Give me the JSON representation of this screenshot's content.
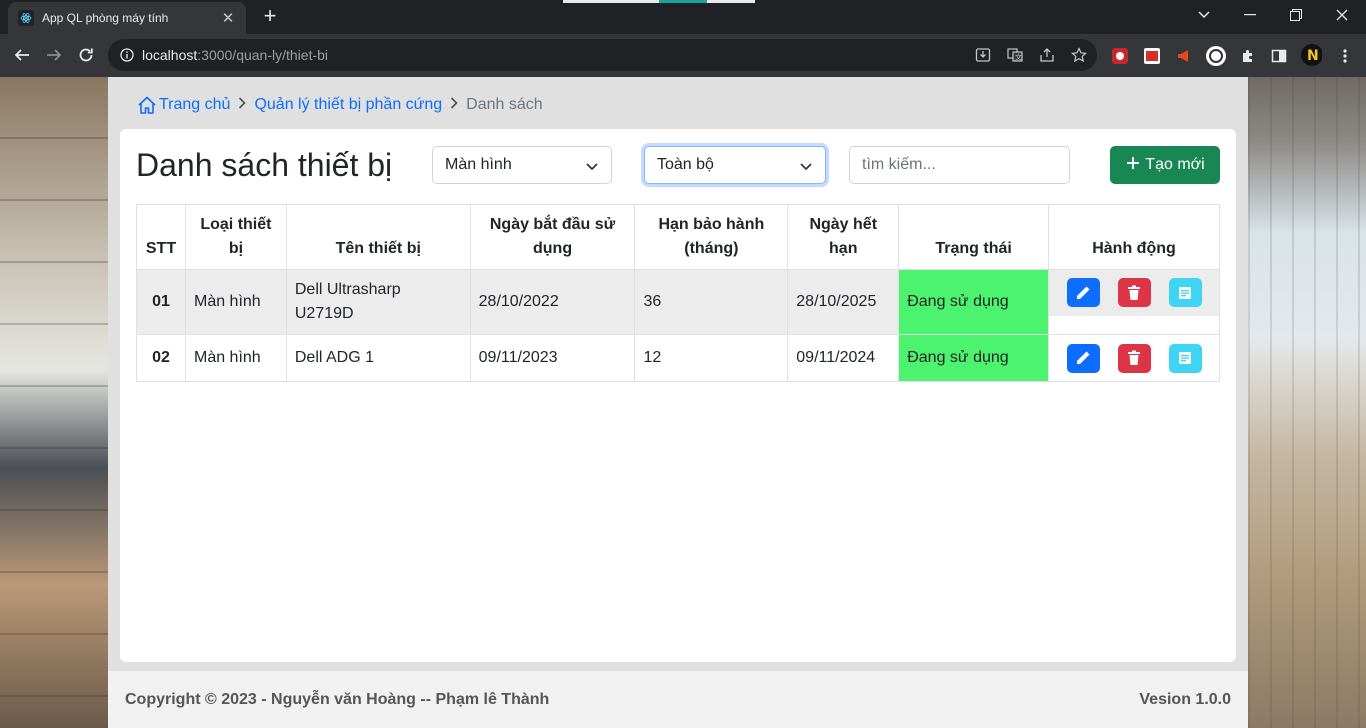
{
  "browser": {
    "tab_title": "App QL phòng máy tính",
    "url_host": "localhost",
    "url_path": ":3000/quan-ly/thiet-bi"
  },
  "breadcrumb": {
    "home": "Trang chủ",
    "section": "Quản lý thiết bị phần cứng",
    "current": "Danh sách"
  },
  "page": {
    "title": "Danh sách thiết bị",
    "type_filter": "Màn hình",
    "status_filter": "Toàn bộ",
    "search_placeholder": "tìm kiếm...",
    "create_label": "Tạo mới"
  },
  "table": {
    "headers": {
      "stt": "STT",
      "type": "Loại thiết bị",
      "name": "Tên thiết bị",
      "start": "Ngày bắt đầu sử dụng",
      "warranty": "Hạn bảo hành (tháng)",
      "expire": "Ngày hết hạn",
      "status": "Trạng thái",
      "actions": "Hành động"
    },
    "rows": [
      {
        "stt": "01",
        "type": "Màn hình",
        "name": "Dell Ultrasharp U2719D",
        "start": "28/10/2022",
        "warranty": "36",
        "expire": "28/10/2025",
        "status": "Đang sử dụng"
      },
      {
        "stt": "02",
        "type": "Màn hình",
        "name": "Dell ADG 1",
        "start": "09/11/2023",
        "warranty": "12",
        "expire": "09/11/2024",
        "status": "Đang sử dụng"
      }
    ]
  },
  "footer": {
    "copyright": "Copyright © 2023 - Nguyễn văn Hoàng -- Phạm lê Thành",
    "version": "Vesion 1.0.0"
  },
  "colors": {
    "primary": "#0d6efd",
    "success": "#198754",
    "danger": "#dc3545",
    "info": "#3dd5f3",
    "status_active": "#4cf36f"
  }
}
